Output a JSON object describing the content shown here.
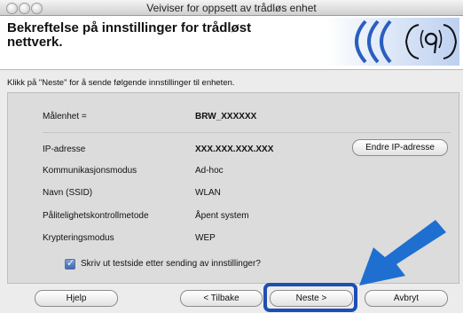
{
  "window": {
    "title": "Veiviser for oppsett av trådløs enhet"
  },
  "header": {
    "title": "Bekreftelse på innstillinger for trådløst nettverk."
  },
  "instruction": "Klikk på \"Neste\" for å sende følgende innstillinger til enheten.",
  "settings": {
    "target_device": {
      "label": "Målenhet =",
      "value": "BRW_XXXXXX"
    },
    "rows": [
      {
        "label": "IP-adresse",
        "value": "XXX.XXX.XXX.XXX"
      },
      {
        "label": "Kommunikasjonsmodus",
        "value": "Ad-hoc"
      },
      {
        "label": "Navn (SSID)",
        "value": "WLAN"
      },
      {
        "label": "Pålitelighetskontrollmetode",
        "value": "Åpent system"
      },
      {
        "label": "Krypteringsmodus",
        "value": "WEP"
      }
    ],
    "change_ip_button": "Endre IP-adresse"
  },
  "print_test_checkbox": {
    "label": "Skriv ut testside etter sending av innstillinger?",
    "checked": true
  },
  "buttons": {
    "help": "Hjelp",
    "back": "< Tilbake",
    "next": "Neste >",
    "cancel": "Avbryt"
  },
  "icons": {
    "logo": "wireless-signal-icon",
    "pointer": "blue-arrow-icon"
  },
  "colors": {
    "accent": "#1d4fb3",
    "arrow": "#1e6fd0"
  }
}
